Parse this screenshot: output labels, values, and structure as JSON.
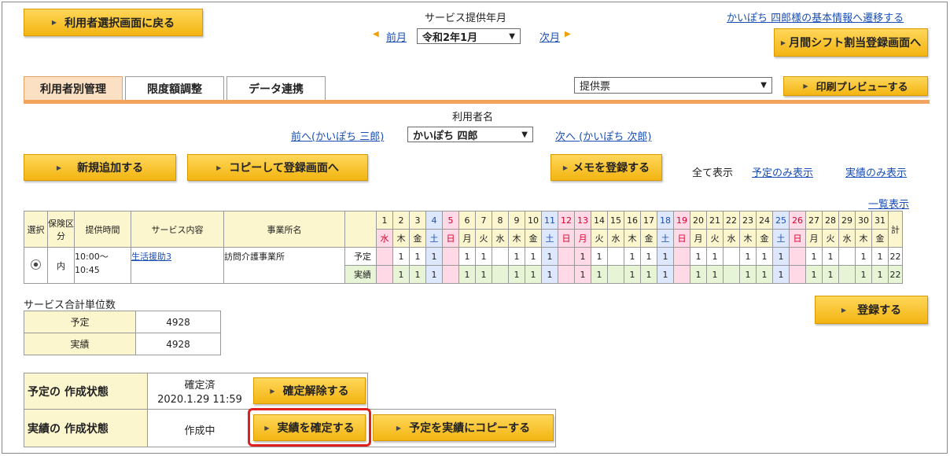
{
  "header": {
    "back_button": "利用者選択画面に戻る",
    "month_label": "サービス提供年月",
    "prev_month": "前月",
    "current_month": "令和2年1月",
    "next_month": "次月",
    "basic_info_link": "かいぽち 四郎様の基本情報へ遷移する",
    "shift_button": "月間シフト割当登録画面へ"
  },
  "tabs": [
    "利用者別管理",
    "限度額調整",
    "データ連携"
  ],
  "print": {
    "select_value": "提供票",
    "preview_button": "印刷プレビューする"
  },
  "user": {
    "label": "利用者名",
    "prev": "前へ(かいぽち 三郎)",
    "current": "かいぽち 四郎",
    "next": "次へ (かいぽち 次郎)"
  },
  "actions": {
    "new_button": "新規追加する",
    "copy_button": "コピーして登録画面へ",
    "memo_button": "メモを登録する",
    "show_all": "全て表示",
    "show_plan": "予定のみ表示",
    "show_actual": "実績のみ表示",
    "list_view": "一覧表示"
  },
  "schedule": {
    "headers": {
      "select": "選択",
      "insurance": "保険区分",
      "time": "提供時間",
      "service": "サービス内容",
      "office": "事業所名",
      "total": "計"
    },
    "days": [
      "1",
      "2",
      "3",
      "4",
      "5",
      "6",
      "7",
      "8",
      "9",
      "10",
      "11",
      "12",
      "13",
      "14",
      "15",
      "16",
      "17",
      "18",
      "19",
      "20",
      "21",
      "22",
      "23",
      "24",
      "25",
      "26",
      "27",
      "28",
      "29",
      "30",
      "31"
    ],
    "weekdays": [
      "水",
      "木",
      "金",
      "土",
      "日",
      "月",
      "火",
      "水",
      "木",
      "金",
      "土",
      "日",
      "月",
      "火",
      "水",
      "木",
      "金",
      "土",
      "日",
      "月",
      "火",
      "水",
      "木",
      "金",
      "土",
      "日",
      "月",
      "火",
      "水",
      "木",
      "金"
    ],
    "row": {
      "insurance": "内",
      "time": "10:00～10:45",
      "service": "生活援助3",
      "office": "訪問介護事業所",
      "plan_label": "予定",
      "actual_label": "実績",
      "plan_marks": [
        "",
        "1",
        "1",
        "1",
        "",
        "1",
        "1",
        "",
        "1",
        "1",
        "1",
        "",
        "1",
        "1",
        "",
        "1",
        "1",
        "1",
        "",
        "1",
        "1",
        "",
        "1",
        "1",
        "1",
        "",
        "1",
        "1",
        "",
        "1",
        "1"
      ],
      "actual_marks": [
        "",
        "1",
        "1",
        "1",
        "",
        "1",
        "1",
        "",
        "1",
        "1",
        "1",
        "",
        "1",
        "1",
        "",
        "1",
        "1",
        "1",
        "",
        "1",
        "1",
        "",
        "1",
        "1",
        "1",
        "",
        "1",
        "1",
        "",
        "1",
        "1"
      ],
      "plan_total": "22",
      "actual_total": "22"
    }
  },
  "register_button": "登録する",
  "summary": {
    "title": "サービス合計単位数",
    "plan_label": "予定",
    "plan_value": "4928",
    "actual_label": "実績",
    "actual_value": "4928"
  },
  "status": {
    "plan_label": "予定の 作成状態",
    "plan_state": "確定済",
    "plan_date": "2020.1.29 11:59",
    "plan_button": "確定解除する",
    "actual_label": "実績の 作成状態",
    "actual_state": "作成中",
    "actual_button": "実績を確定する",
    "copy_button": "予定を実績にコピーする"
  }
}
